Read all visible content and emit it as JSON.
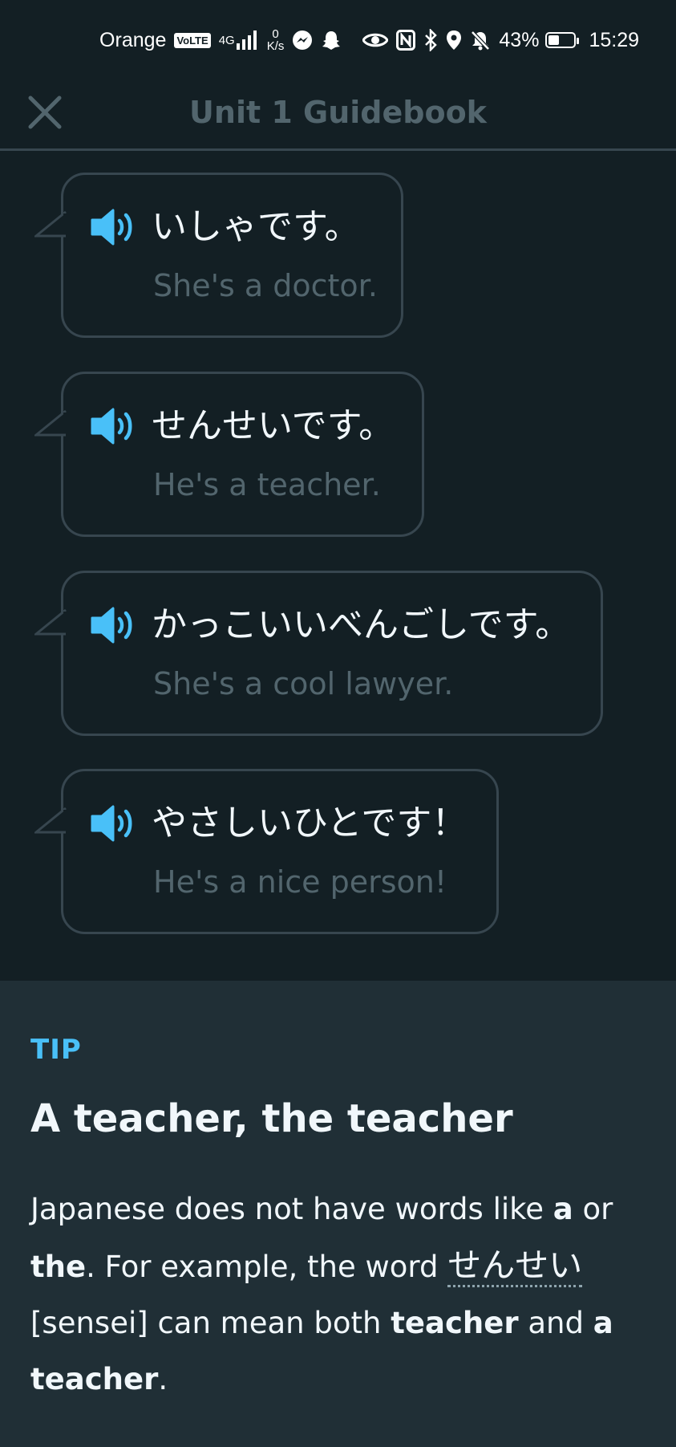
{
  "status_bar": {
    "carrier": "Orange",
    "volte": "VoLTE",
    "network": "4G",
    "data_rate_value": "0",
    "data_rate_unit": "K/s",
    "battery_percent": "43%",
    "battery_level": 0.43,
    "time": "15:29",
    "icons": [
      "messenger-icon",
      "snapchat-icon",
      "eye-icon",
      "nfc-icon",
      "bluetooth-icon",
      "location-icon",
      "bell-muted-icon",
      "battery-icon"
    ]
  },
  "header": {
    "title": "Unit 1 Guidebook",
    "close_icon": "close-icon"
  },
  "phrases": [
    {
      "japanese": "いしゃです。",
      "english": "She's a doctor."
    },
    {
      "japanese": "せんせいです。",
      "english": "He's a teacher."
    },
    {
      "japanese": "かっこいいべんごしです。",
      "english": "She's a cool lawyer."
    },
    {
      "japanese": "やさしいひとです！",
      "english": "He's a nice person!"
    }
  ],
  "tip": {
    "label": "TIP",
    "title": "A teacher, the teacher",
    "body": {
      "p1": "Japanese does not have words like ",
      "b1": "a",
      "p2": " or ",
      "b2": "the",
      "p3": ". For example, the word ",
      "word": "せんせい",
      "p4": " [sensei] can mean both ",
      "b3": "teacher",
      "p5": " and ",
      "b4": "a teacher",
      "p6": "."
    }
  },
  "colors": {
    "background": "#131f24",
    "accent_blue": "#49c0f8",
    "border": "#37464f",
    "muted_text": "#52656d",
    "tip_background": "#202f36"
  }
}
